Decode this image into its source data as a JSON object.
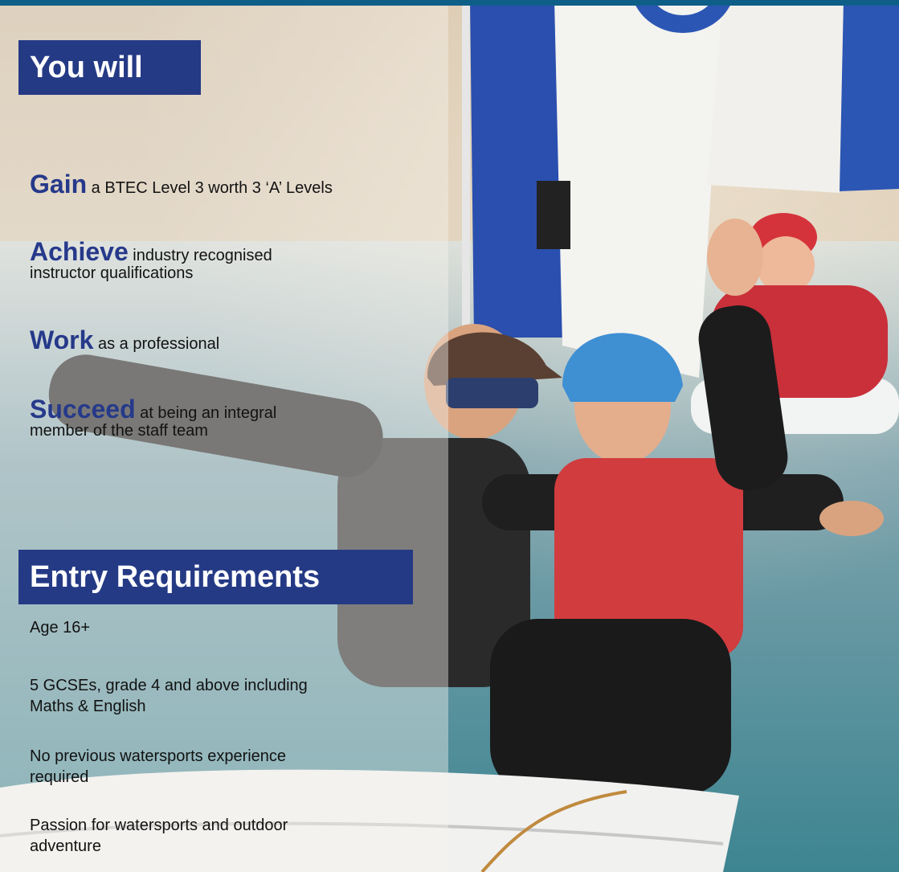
{
  "you_will": {
    "heading": "You will",
    "items": [
      {
        "keyword": "Gain",
        "text": " a BTEC Level 3 worth 3 ‘A’ Levels"
      },
      {
        "keyword": "Achieve",
        "text": " industry recognised",
        "text2": "instructor qualifications"
      },
      {
        "keyword": "Work",
        "text": " as a professional"
      },
      {
        "keyword": "Succeed",
        "text": " at being an integral",
        "text2": "member of the staff team"
      }
    ]
  },
  "entry": {
    "heading": "Entry Requirements",
    "items": [
      {
        "line1": "Age 16+"
      },
      {
        "line1": "5 GCSEs, grade 4 and above including",
        "line2": "Maths & English"
      },
      {
        "line1": "No previous watersports experience",
        "line2": "required"
      },
      {
        "line1": "Passion for watersports and outdoor",
        "line2": "adventure"
      }
    ]
  },
  "colors": {
    "heading_bg": "#253a85",
    "keyword": "#26398a",
    "top_bar": "#0d5f88"
  }
}
